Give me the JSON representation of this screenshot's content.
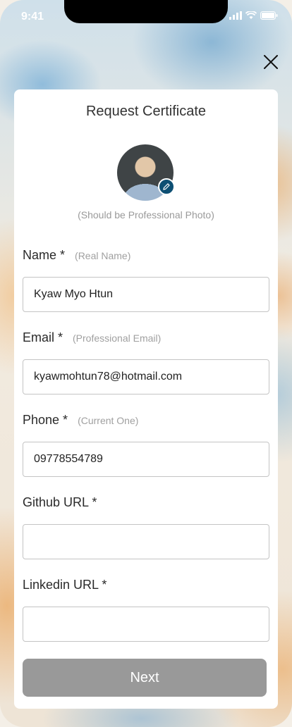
{
  "status_bar": {
    "time": "9:41"
  },
  "form": {
    "title": "Request Certificate",
    "photo_hint": "(Should be Professional Photo)",
    "fields": [
      {
        "label": "Name *",
        "hint": "(Real Name)",
        "value": "Kyaw Myo Htun"
      },
      {
        "label": "Email *",
        "hint": "(Professional Email)",
        "value": "kyawmohtun78@hotmail.com"
      },
      {
        "label": "Phone *",
        "hint": "(Current One)",
        "value": "09778554789"
      },
      {
        "label": "Github URL *",
        "hint": "",
        "value": ""
      },
      {
        "label": "Linkedin URL *",
        "hint": "",
        "value": ""
      }
    ],
    "next_label": "Next"
  },
  "icons": [
    "close-icon",
    "pencil-icon",
    "signal-icon",
    "wifi-icon",
    "battery-icon"
  ],
  "colors": {
    "button": "#999999",
    "edit_badge": "#0d4f73"
  }
}
